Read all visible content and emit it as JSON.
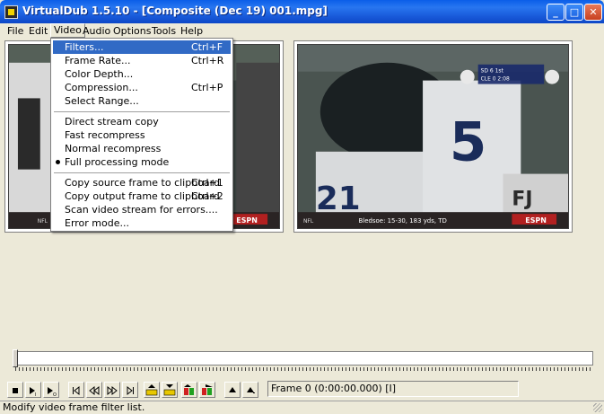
{
  "window": {
    "title": "VirtualDub 1.5.10 - [Composite (Dec 19) 001.mpg]",
    "minimize_glyph": "_",
    "maximize_glyph": "□",
    "close_glyph": "✕"
  },
  "menubar": [
    {
      "label": "File"
    },
    {
      "label": "Edit"
    },
    {
      "label": "Video"
    },
    {
      "label": "Audio"
    },
    {
      "label": "Options"
    },
    {
      "label": "Tools"
    },
    {
      "label": "Help"
    }
  ],
  "video_menu": [
    {
      "label": "Filters...",
      "shortcut": "Ctrl+F",
      "highlighted": true
    },
    {
      "label": "Frame Rate...",
      "shortcut": "Ctrl+R"
    },
    {
      "label": "Color Depth...",
      "shortcut": ""
    },
    {
      "label": "Compression...",
      "shortcut": "Ctrl+P"
    },
    {
      "label": "Select Range...",
      "shortcut": ""
    },
    {
      "label": "Direct stream copy",
      "shortcut": ""
    },
    {
      "label": "Fast recompress",
      "shortcut": ""
    },
    {
      "label": "Normal recompress",
      "shortcut": ""
    },
    {
      "label": "Full processing mode",
      "shortcut": "",
      "checked": true
    },
    {
      "label": "Copy source frame to clipboard",
      "shortcut": "Ctrl+1"
    },
    {
      "label": "Copy output frame to clipboard",
      "shortcut": "Ctrl+2"
    },
    {
      "label": "Scan video stream for errors....",
      "shortcut": ""
    },
    {
      "label": "Error mode...",
      "shortcut": ""
    }
  ],
  "output_pane": {
    "ticker_text": "Bledsoe: 15-30, 183 yds, TD",
    "score_lines": [
      "SD 6 1st",
      "CLE 0 2:08"
    ]
  },
  "broadcast_logos": [
    "NFL",
    "ESPN"
  ],
  "frame_indicator": "Frame 0 (0:00:00.000) [I]",
  "status_text": "Modify video frame filter list.",
  "toolbar": [
    {
      "name": "stop-icon"
    },
    {
      "name": "play-input-icon"
    },
    {
      "name": "play-output-icon"
    },
    {
      "name": "go-start-icon"
    },
    {
      "name": "step-back-icon"
    },
    {
      "name": "step-forward-icon"
    },
    {
      "name": "go-end-icon"
    },
    {
      "name": "prev-keyframe-icon"
    },
    {
      "name": "next-keyframe-icon"
    },
    {
      "name": "scene-back-icon"
    },
    {
      "name": "scene-forward-icon"
    },
    {
      "name": "mark-in-icon"
    },
    {
      "name": "mark-out-icon"
    }
  ],
  "colors": {
    "title_bar": "#1858d8",
    "menu_highlight": "#316ac5",
    "window_face": "#ece9d8"
  }
}
